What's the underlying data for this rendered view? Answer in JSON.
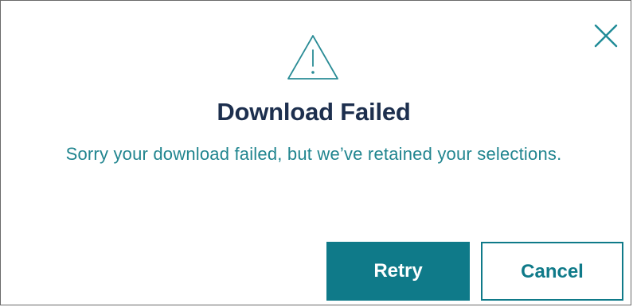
{
  "dialog": {
    "title": "Download Failed",
    "message": "Sorry your download failed, but we’ve retained your selections.",
    "warning_icon": "warning-triangle-icon",
    "close_icon": "close-icon",
    "buttons": {
      "retry_label": "Retry",
      "cancel_label": "Cancel"
    }
  },
  "colors": {
    "title": "#1d2f4e",
    "accent": "#0f7a89",
    "message": "#21858f",
    "border": "#6a6a6a"
  }
}
